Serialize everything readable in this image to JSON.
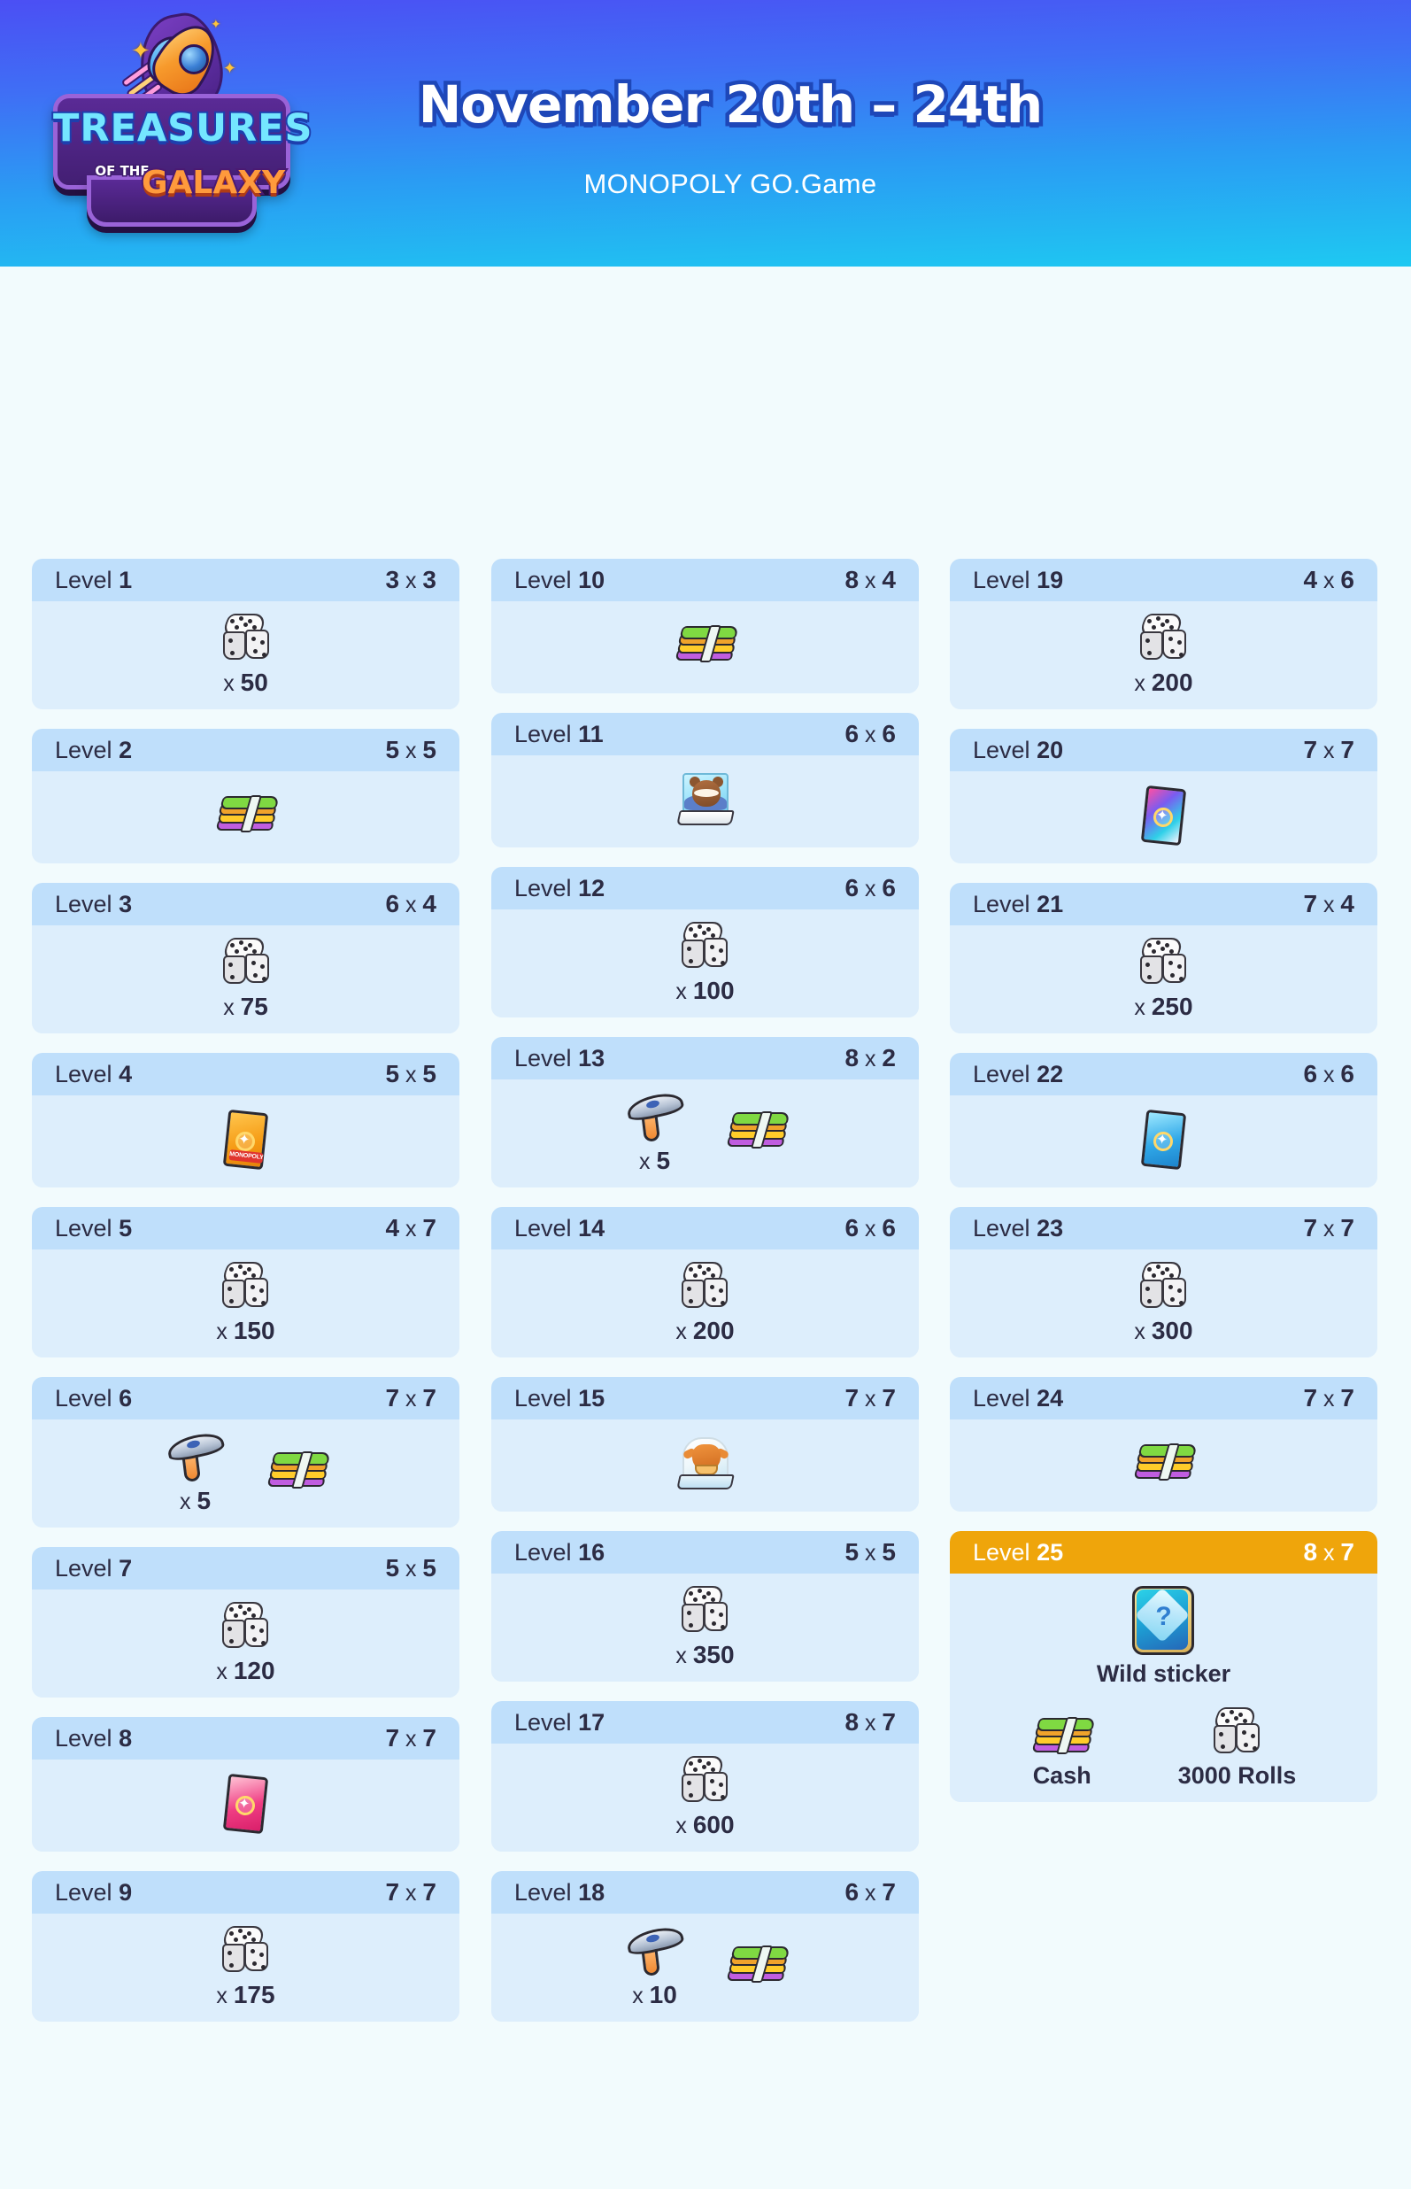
{
  "header": {
    "logo": {
      "line1": "TREASURES",
      "line2": "OF THE",
      "line3": "GALAXY"
    },
    "title": "November 20th – 24th",
    "subtitle": "MONOPOLY GO.Game"
  },
  "theme": {
    "header_gradient_top": "#4b4ff4",
    "header_gradient_bottom": "#1ec9f2",
    "page_background": "#f2fbfd",
    "card_header": "#bfdffb",
    "card_body": "#ddeefc",
    "gold_header": "#efa50b",
    "text": "#2c2c44"
  },
  "labels": {
    "level_prefix": "Level",
    "times": "x"
  },
  "columns": [
    {
      "cards": [
        {
          "level": "1",
          "mult_a": "3",
          "mult_b": "3",
          "rewards": [
            {
              "icon": "dice-icon",
              "qty_prefix": "x",
              "qty": "50"
            }
          ]
        },
        {
          "level": "2",
          "mult_a": "5",
          "mult_b": "5",
          "rewards": [
            {
              "icon": "cash-icon"
            }
          ]
        },
        {
          "level": "3",
          "mult_a": "6",
          "mult_b": "4",
          "rewards": [
            {
              "icon": "dice-icon",
              "qty_prefix": "x",
              "qty": "75"
            }
          ]
        },
        {
          "level": "4",
          "mult_a": "5",
          "mult_b": "5",
          "rewards": [
            {
              "icon": "sticker-pack-orange-icon"
            }
          ]
        },
        {
          "level": "5",
          "mult_a": "4",
          "mult_b": "7",
          "rewards": [
            {
              "icon": "dice-icon",
              "qty_prefix": "x",
              "qty": "150"
            }
          ]
        },
        {
          "level": "6",
          "mult_a": "7",
          "mult_b": "7",
          "rewards": [
            {
              "icon": "hammer-icon",
              "qty_prefix": "x",
              "qty": "5"
            },
            {
              "icon": "cash-icon"
            }
          ]
        },
        {
          "level": "7",
          "mult_a": "5",
          "mult_b": "5",
          "rewards": [
            {
              "icon": "dice-icon",
              "qty_prefix": "x",
              "qty": "120"
            }
          ]
        },
        {
          "level": "8",
          "mult_a": "7",
          "mult_b": "7",
          "rewards": [
            {
              "icon": "sticker-pack-pink-icon"
            }
          ]
        },
        {
          "level": "9",
          "mult_a": "7",
          "mult_b": "7",
          "rewards": [
            {
              "icon": "dice-icon",
              "qty_prefix": "x",
              "qty": "175"
            }
          ]
        }
      ]
    },
    {
      "cards": [
        {
          "level": "10",
          "mult_a": "8",
          "mult_b": "4",
          "rewards": [
            {
              "icon": "cash-icon"
            }
          ]
        },
        {
          "level": "11",
          "mult_a": "6",
          "mult_b": "6",
          "rewards": [
            {
              "icon": "raccoon-sticker-icon"
            }
          ]
        },
        {
          "level": "12",
          "mult_a": "6",
          "mult_b": "6",
          "rewards": [
            {
              "icon": "dice-icon",
              "qty_prefix": "x",
              "qty": "100"
            }
          ]
        },
        {
          "level": "13",
          "mult_a": "8",
          "mult_b": "2",
          "rewards": [
            {
              "icon": "hammer-icon",
              "qty_prefix": "x",
              "qty": "5"
            },
            {
              "icon": "cash-icon"
            }
          ]
        },
        {
          "level": "14",
          "mult_a": "6",
          "mult_b": "6",
          "rewards": [
            {
              "icon": "dice-icon",
              "qty_prefix": "x",
              "qty": "200"
            }
          ]
        },
        {
          "level": "15",
          "mult_a": "7",
          "mult_b": "7",
          "rewards": [
            {
              "icon": "groot-sticker-icon"
            }
          ]
        },
        {
          "level": "16",
          "mult_a": "5",
          "mult_b": "5",
          "rewards": [
            {
              "icon": "dice-icon",
              "qty_prefix": "x",
              "qty": "350"
            }
          ]
        },
        {
          "level": "17",
          "mult_a": "8",
          "mult_b": "7",
          "rewards": [
            {
              "icon": "dice-icon",
              "qty_prefix": "x",
              "qty": "600"
            }
          ]
        },
        {
          "level": "18",
          "mult_a": "6",
          "mult_b": "7",
          "rewards": [
            {
              "icon": "hammer-icon",
              "qty_prefix": "x",
              "qty": "10"
            },
            {
              "icon": "cash-icon"
            }
          ]
        }
      ]
    },
    {
      "cards": [
        {
          "level": "19",
          "mult_a": "4",
          "mult_b": "6",
          "rewards": [
            {
              "icon": "dice-icon",
              "qty_prefix": "x",
              "qty": "200"
            }
          ]
        },
        {
          "level": "20",
          "mult_a": "7",
          "mult_b": "7",
          "rewards": [
            {
              "icon": "sticker-pack-rainbow-icon"
            }
          ]
        },
        {
          "level": "21",
          "mult_a": "7",
          "mult_b": "4",
          "rewards": [
            {
              "icon": "dice-icon",
              "qty_prefix": "x",
              "qty": "250"
            }
          ]
        },
        {
          "level": "22",
          "mult_a": "6",
          "mult_b": "6",
          "rewards": [
            {
              "icon": "sticker-pack-blue-icon"
            }
          ]
        },
        {
          "level": "23",
          "mult_a": "7",
          "mult_b": "7",
          "rewards": [
            {
              "icon": "dice-icon",
              "qty_prefix": "x",
              "qty": "300"
            }
          ]
        },
        {
          "level": "24",
          "mult_a": "7",
          "mult_b": "7",
          "rewards": [
            {
              "icon": "cash-icon"
            }
          ]
        },
        {
          "level": "25",
          "mult_a": "8",
          "mult_b": "7",
          "highlight": true,
          "rewards": [
            {
              "icon": "wild-sticker-icon",
              "caption": "Wild sticker"
            }
          ],
          "rewards_row2": [
            {
              "icon": "cash-icon",
              "caption": "Cash"
            },
            {
              "icon": "dice-icon",
              "caption": "3000 Rolls"
            }
          ]
        }
      ]
    }
  ]
}
